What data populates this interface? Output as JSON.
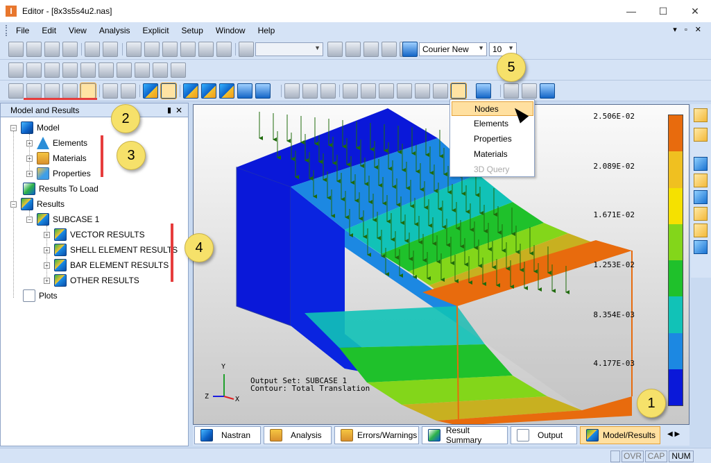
{
  "window": {
    "title": "Editor - [8x3s5s4u2.nas]",
    "app_icon": "I",
    "minimize_label": "—",
    "maximize_label": "☐",
    "close_label": "✕"
  },
  "menu": {
    "items": [
      "File",
      "Edit",
      "View",
      "Analysis",
      "Explicit",
      "Setup",
      "Window",
      "Help"
    ],
    "mdi_controls": "▾ ▫ ✕"
  },
  "toolbar": {
    "style_combo": "",
    "font_combo": "Courier New",
    "size_combo": "10"
  },
  "left_panel": {
    "title": "Model and Results",
    "pin": "▮",
    "close": "✕",
    "tree": [
      {
        "label": "Model",
        "expander": "−",
        "icon": "model-cube-icon"
      },
      {
        "label": "Elements",
        "expander": "+",
        "icon": "elements-icon"
      },
      {
        "label": "Materials",
        "expander": "+",
        "icon": "materials-icon"
      },
      {
        "label": "Properties",
        "expander": "+",
        "icon": "properties-icon"
      },
      {
        "label": "Results To Load",
        "expander": "",
        "icon": "results-to-load-icon"
      },
      {
        "label": "Results",
        "expander": "−",
        "icon": "results-cube-icon"
      },
      {
        "label": "SUBCASE 1",
        "expander": "−",
        "icon": "subcase-icon"
      },
      {
        "label": "VECTOR RESULTS",
        "expander": "+",
        "icon": "vector-results-icon"
      },
      {
        "label": "SHELL ELEMENT RESULTS",
        "expander": "+",
        "icon": "shell-results-icon"
      },
      {
        "label": "BAR ELEMENT RESULTS",
        "expander": "+",
        "icon": "bar-results-icon"
      },
      {
        "label": "OTHER RESULTS",
        "expander": "+",
        "icon": "other-results-icon"
      },
      {
        "label": "Plots",
        "expander": "",
        "icon": "plots-icon"
      }
    ]
  },
  "viewport": {
    "output_set": "Output Set: SUBCASE 1",
    "contour": "Contour: Total Translation",
    "axis_y": "Y",
    "axis_z": "Z",
    "axis_x": "X",
    "legend_labels": [
      "2.506E-02",
      "2.089E-02",
      "1.671E-02",
      "1.253E-02",
      "8.354E-03",
      "4.177E-03"
    ],
    "legend_colors": [
      "#e86b0d",
      "#f0c020",
      "#f5e100",
      "#83d61a",
      "#1fc12b",
      "#11c2b7",
      "#1c88e2",
      "#0a18d9"
    ]
  },
  "dropdown": {
    "items": [
      {
        "label": "Nodes",
        "state": "hover"
      },
      {
        "label": "Elements",
        "state": "normal"
      },
      {
        "label": "Properties",
        "state": "normal"
      },
      {
        "label": "Materials",
        "state": "normal"
      },
      {
        "label": "3D Query",
        "state": "disabled"
      }
    ]
  },
  "tabs": [
    {
      "label": "Nastran",
      "active": false
    },
    {
      "label": "Analysis",
      "active": false
    },
    {
      "label": "Errors/Warnings",
      "active": false
    },
    {
      "label": "Result Summary",
      "active": false
    },
    {
      "label": "Output",
      "active": false
    },
    {
      "label": "Model/Results",
      "active": true
    }
  ],
  "tab_scroll": "◀ ▶",
  "status": {
    "ovr": "OVR",
    "cap": "CAP",
    "num": "NUM"
  },
  "callouts": [
    "1",
    "2",
    "3",
    "4",
    "5"
  ]
}
